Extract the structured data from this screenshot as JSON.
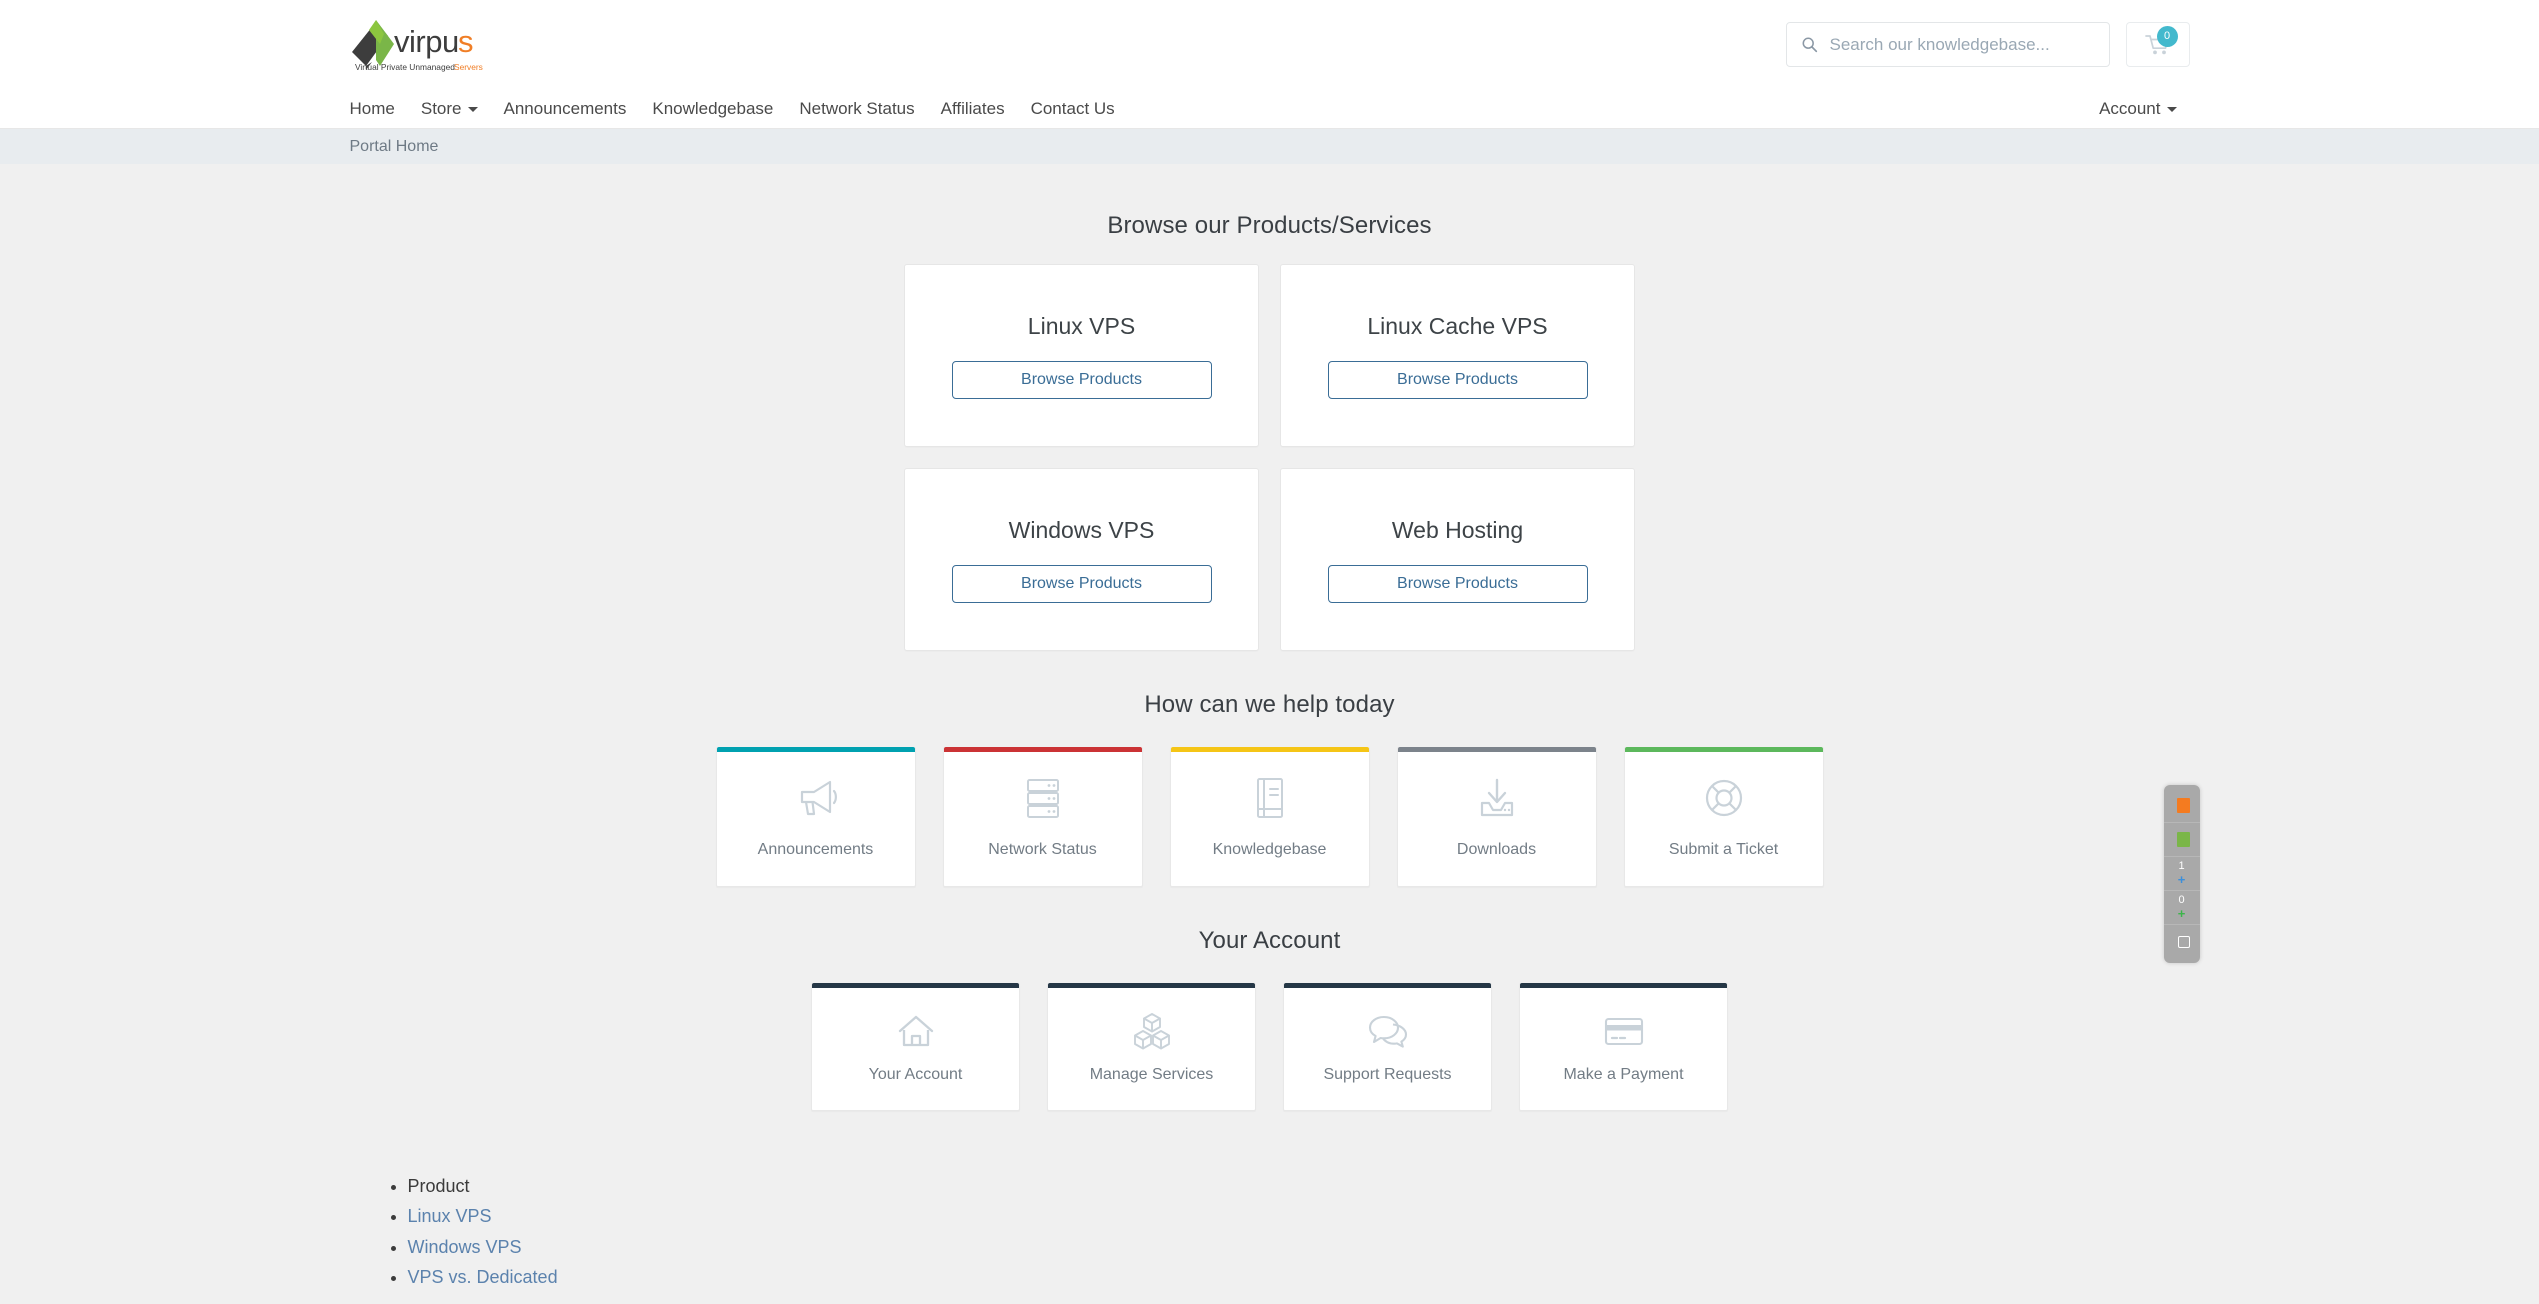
{
  "brand": {
    "name": "virpus",
    "name_main": "virpu",
    "name_accent": "s",
    "tagline_main": "Virtual Private Unmanaged ",
    "tagline_accent": "Servers",
    "green": "#7ab648",
    "orange": "#f07e26",
    "dark": "#3d3d3d"
  },
  "header": {
    "search": {
      "placeholder": "Search our knowledgebase...",
      "value": "",
      "icon": "search-icon"
    },
    "cart": {
      "icon": "shopping-cart-icon",
      "count": "0",
      "badge_color": "#43b9cd"
    }
  },
  "nav": {
    "items": [
      {
        "label": "Home",
        "has_caret": false
      },
      {
        "label": "Store",
        "has_caret": true
      },
      {
        "label": "Announcements",
        "has_caret": false
      },
      {
        "label": "Knowledgebase",
        "has_caret": false
      },
      {
        "label": "Network Status",
        "has_caret": false
      },
      {
        "label": "Affiliates",
        "has_caret": false
      },
      {
        "label": "Contact Us",
        "has_caret": false
      }
    ],
    "account": {
      "label": "Account",
      "has_caret": true
    }
  },
  "breadcrumb": {
    "current": "Portal Home"
  },
  "products_section": {
    "title": "Browse our Products/Services",
    "cards": [
      {
        "title": "Linux VPS",
        "button": "Browse Products"
      },
      {
        "title": "Linux Cache VPS",
        "button": "Browse Products"
      },
      {
        "title": "Windows VPS",
        "button": "Browse Products"
      },
      {
        "title": "Web Hosting",
        "button": "Browse Products"
      }
    ]
  },
  "help_section": {
    "title": "How can we help today",
    "tiles": [
      {
        "label": "Announcements",
        "icon": "megaphone-icon",
        "color": "#00a1b0"
      },
      {
        "label": "Network Status",
        "icon": "server-rack-icon",
        "color": "#cb3335"
      },
      {
        "label": "Knowledgebase",
        "icon": "book-icon",
        "color": "#f5c516"
      },
      {
        "label": "Downloads",
        "icon": "download-tray-icon",
        "color": "#7c838b"
      },
      {
        "label": "Submit a Ticket",
        "icon": "lifebuoy-icon",
        "color": "#5cb85c"
      }
    ]
  },
  "account_section": {
    "title": "Your Account",
    "tiles": [
      {
        "label": "Your Account",
        "icon": "home-icon",
        "color": "#253746"
      },
      {
        "label": "Manage Services",
        "icon": "cubes-icon",
        "color": "#253746"
      },
      {
        "label": "Support Requests",
        "icon": "chat-bubbles-icon",
        "color": "#253746"
      },
      {
        "label": "Make a Payment",
        "icon": "credit-card-icon",
        "color": "#253746"
      }
    ]
  },
  "footer": {
    "items": [
      {
        "label": "Product",
        "is_link": false
      },
      {
        "label": "Linux VPS",
        "is_link": true
      },
      {
        "label": "Windows VPS",
        "is_link": true
      },
      {
        "label": "VPS vs. Dedicated",
        "is_link": true
      }
    ]
  },
  "share_widget": {
    "items": [
      {
        "type": "square",
        "color": "#f47b20",
        "label": ""
      },
      {
        "type": "square",
        "color": "#7ab648",
        "label": ""
      },
      {
        "type": "count",
        "count": "1",
        "plus": "+",
        "plus_color": "#3b8fdc"
      },
      {
        "type": "count",
        "count": "0",
        "plus": "+",
        "plus_color": "#3cb54a"
      },
      {
        "type": "outline",
        "label": ""
      }
    ]
  }
}
